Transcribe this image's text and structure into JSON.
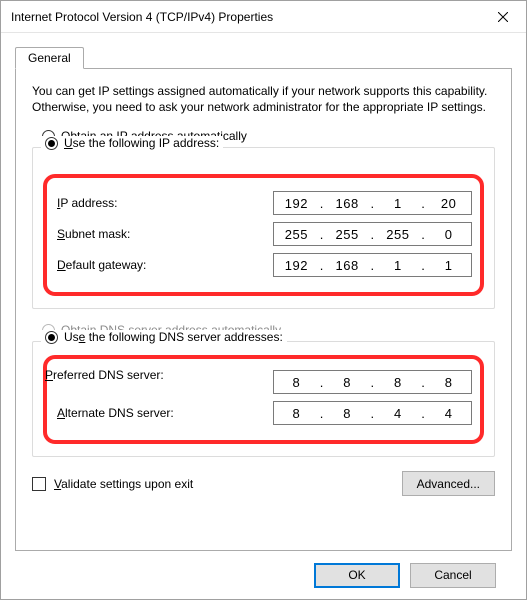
{
  "window": {
    "title": "Internet Protocol Version 4 (TCP/IPv4) Properties",
    "tab_label": "General",
    "intro": "You can get IP settings assigned automatically if your network supports this capability. Otherwise, you need to ask your network administrator for the appropriate IP settings."
  },
  "ip_section": {
    "auto_label_pre": "O",
    "auto_label_post": "btain an IP address automatically",
    "auto_selected": false,
    "manual_label_pre": "U",
    "manual_label_post": "se the following IP address:",
    "manual_selected": true,
    "fields": {
      "ip": {
        "label_pre": "I",
        "label_post": "P address:",
        "o1": "192",
        "o2": "168",
        "o3": "1",
        "o4": "20"
      },
      "subnet": {
        "label_pre": "S",
        "label_post": "ubnet mask:",
        "o1": "255",
        "o2": "255",
        "o3": "255",
        "o4": "0"
      },
      "gateway": {
        "label_pre": "D",
        "label_post": "efault gateway:",
        "o1": "192",
        "o2": "168",
        "o3": "1",
        "o4": "1"
      }
    }
  },
  "dns_section": {
    "auto_label_pre": "O",
    "auto_label_post": "btain DNS server address automatically",
    "auto_enabled": false,
    "manual_label_pre": "Us",
    "manual_label_post": "e the following DNS server addresses:",
    "manual_selected": true,
    "fields": {
      "preferred": {
        "label_pre": "P",
        "label_post": "referred DNS server:",
        "o1": "8",
        "o2": "8",
        "o3": "8",
        "o4": "8"
      },
      "alternate": {
        "label_pre": "A",
        "label_post": "lternate DNS server:",
        "o1": "8",
        "o2": "8",
        "o3": "4",
        "o4": "4"
      }
    }
  },
  "exit": {
    "validate_label_pre": "V",
    "validate_label_post": "alidate settings upon exit",
    "validate_checked": false,
    "advanced_label": "Advanced..."
  },
  "footer": {
    "ok_label": "OK",
    "cancel_label": "Cancel"
  }
}
